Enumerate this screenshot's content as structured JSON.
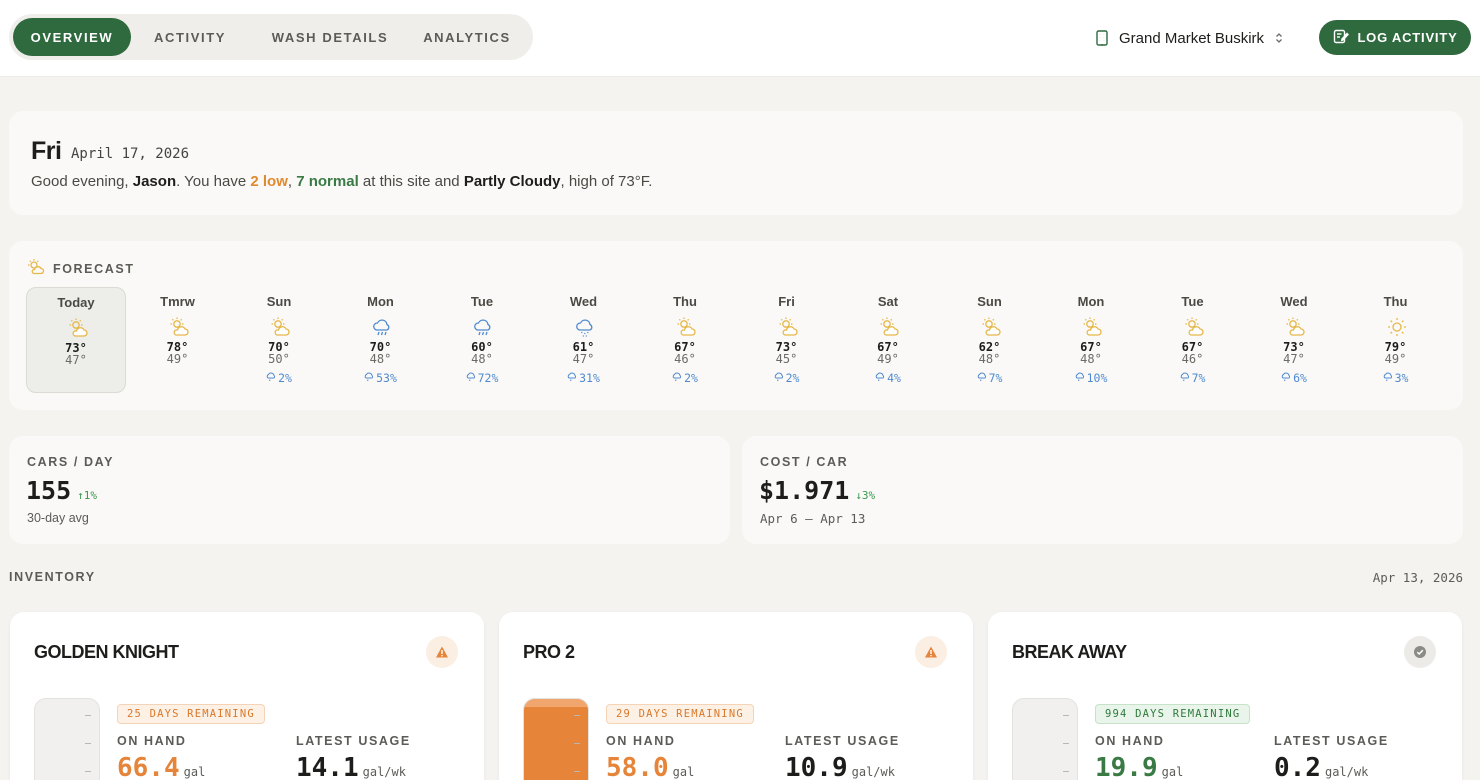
{
  "nav": {
    "tabs": [
      "OVERVIEW",
      "ACTIVITY",
      "WASH DETAILS",
      "ANALYTICS"
    ],
    "active_tab": "OVERVIEW",
    "site": "Grand Market Buskirk",
    "log_button": "LOG ACTIVITY"
  },
  "greeting": {
    "day": "Fri",
    "date": "April 17, 2026",
    "prefix": "Good evening, ",
    "name": "Jason",
    "mid1": ". You have ",
    "low": "2 low",
    "comma": ", ",
    "normal": "7 normal",
    "mid2": " at this site and ",
    "weather": "Partly Cloudy",
    "suffix": ", high of 73°F."
  },
  "forecast": {
    "title": "FORECAST",
    "days": [
      {
        "name": "Today",
        "icon": "partly-cloudy-icon",
        "hi": "73°",
        "lo": "47°",
        "precip": ""
      },
      {
        "name": "Tmrw",
        "icon": "partly-cloudy-icon",
        "hi": "78°",
        "lo": "49°",
        "precip": ""
      },
      {
        "name": "Sun",
        "icon": "partly-cloudy-icon",
        "hi": "70°",
        "lo": "50°",
        "precip": "2%"
      },
      {
        "name": "Mon",
        "icon": "rain-icon",
        "hi": "70°",
        "lo": "48°",
        "precip": "53%"
      },
      {
        "name": "Tue",
        "icon": "rain-icon",
        "hi": "60°",
        "lo": "48°",
        "precip": "72%"
      },
      {
        "name": "Wed",
        "icon": "drizzle-icon",
        "hi": "61°",
        "lo": "47°",
        "precip": "31%"
      },
      {
        "name": "Thu",
        "icon": "partly-cloudy-icon",
        "hi": "67°",
        "lo": "46°",
        "precip": "2%"
      },
      {
        "name": "Fri",
        "icon": "partly-cloudy-icon",
        "hi": "73°",
        "lo": "45°",
        "precip": "2%"
      },
      {
        "name": "Sat",
        "icon": "partly-cloudy-icon",
        "hi": "67°",
        "lo": "49°",
        "precip": "4%"
      },
      {
        "name": "Sun",
        "icon": "partly-cloudy-icon",
        "hi": "62°",
        "lo": "48°",
        "precip": "7%"
      },
      {
        "name": "Mon",
        "icon": "partly-cloudy-icon",
        "hi": "67°",
        "lo": "48°",
        "precip": "10%"
      },
      {
        "name": "Tue",
        "icon": "partly-cloudy-icon",
        "hi": "67°",
        "lo": "46°",
        "precip": "7%"
      },
      {
        "name": "Wed",
        "icon": "partly-cloudy-icon",
        "hi": "73°",
        "lo": "47°",
        "precip": "6%"
      },
      {
        "name": "Thu",
        "icon": "sun-icon",
        "hi": "79°",
        "lo": "49°",
        "precip": "3%"
      }
    ]
  },
  "stats": {
    "cars": {
      "label": "CARS / DAY",
      "value": "155",
      "change": "↑1%",
      "sub": "30-day avg"
    },
    "cost": {
      "label": "COST / CAR",
      "value": "$1.971",
      "change": "↓3%",
      "sub": "Apr 6 – Apr 13"
    }
  },
  "inventory": {
    "title": "INVENTORY",
    "date": "Apr 13, 2026",
    "on_hand_label": "ON HAND",
    "usage_label": "LATEST USAGE",
    "items": [
      {
        "name": "GOLDEN KNIGHT",
        "status": "warning",
        "days": "25 DAYS REMAINING",
        "on_hand": "66.4",
        "on_hand_unit": "gal",
        "usage": "14.1",
        "usage_unit": "gal/wk",
        "tank_fill": 0.0
      },
      {
        "name": "PRO 2",
        "status": "warning",
        "days": "29 DAYS REMAINING",
        "on_hand": "58.0",
        "on_hand_unit": "gal",
        "usage": "10.9",
        "usage_unit": "gal/wk",
        "tank_fill": 1.0
      },
      {
        "name": "BREAK AWAY",
        "status": "ok",
        "days": "994 DAYS REMAINING",
        "on_hand": "19.9",
        "on_hand_unit": "gal",
        "usage": "0.2",
        "usage_unit": "gal/wk",
        "tank_fill": 0.0
      }
    ]
  },
  "colors": {
    "brand": "#2f6a3e",
    "warn": "#e6843a",
    "ok": "#3a7a45",
    "precip": "#4f8ad0"
  }
}
